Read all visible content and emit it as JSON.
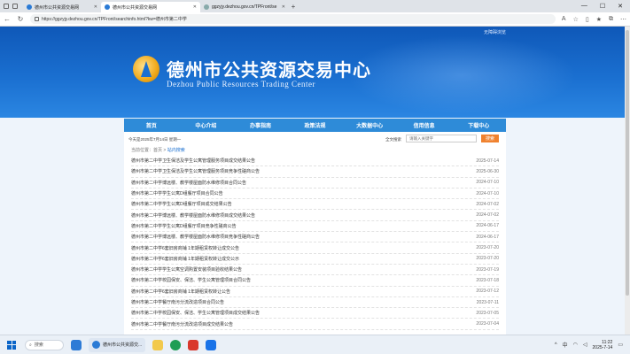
{
  "browser": {
    "tabs": [
      {
        "label": "德州市公共资源交易网",
        "active": false
      },
      {
        "label": "德州市公共资源交易网",
        "active": true
      },
      {
        "label": "ggzyjy.dezhou.gov.cn/TPFront/se",
        "active": false
      }
    ],
    "new_tab_label": "+",
    "url": "https://ggzyjy.dezhou.gov.cn/TPFront/searchinfo.html?kw=德州市第二中学"
  },
  "site": {
    "top_right_text": "无障碍浏览",
    "title_cn": "德州市公共资源交易中心",
    "title_en": "Dezhou Public Resources Trading Center"
  },
  "nav": [
    "首页",
    "中心介绍",
    "办事指南",
    "政策法规",
    "大数据中心",
    "信用信息",
    "下载中心"
  ],
  "info": {
    "date_text": "今天是2025年7月14日 星期一",
    "search_label": "全文搜索",
    "search_placeholder": "请输入关键字",
    "search_button": "搜索"
  },
  "breadcrumb": {
    "prefix": "当前位置：",
    "home": "首页",
    "sep": " > ",
    "current": "站内搜索"
  },
  "results": [
    {
      "title": "德州市第二中学卫生保洁及学生公寓管理服务项目成交结果公告",
      "date": "2025-07-14"
    },
    {
      "title": "德州市第二中学卫生保洁及学生公寓管理服务项目竞争性磋商公告",
      "date": "2025-06-30"
    },
    {
      "title": "德州市第二中学博远楼、教学楼屋面防水维修项目合同公告",
      "date": "2024-07-10"
    },
    {
      "title": "德州市第二中学学生公寓D组餐厅项目合同公告",
      "date": "2024-07-10"
    },
    {
      "title": "德州市第二中学学生公寓D组餐厅项目成交结果公告",
      "date": "2024-07-02"
    },
    {
      "title": "德州市第二中学博远楼、教学楼屋面防水维修项目成交结果公告",
      "date": "2024-07-02"
    },
    {
      "title": "德州市第二中学学生公寓D组餐厅项目竞争性磋商公告",
      "date": "2024-06-17"
    },
    {
      "title": "德州市第二中学博远楼、教学楼屋面防水维修项目竞争性磋商公告",
      "date": "2024-06-17"
    },
    {
      "title": "德州市第二中学6套旧房商铺 1年期租赁权转让成交公告",
      "date": "2023-07-20"
    },
    {
      "title": "德州市第二中学6套旧房商铺 1年期租赁权转让成交公示",
      "date": "2023-07-20"
    },
    {
      "title": "德州市第二中学学生公寓空调购置安装项目验收结果公告",
      "date": "2023-07-19"
    },
    {
      "title": "德州市第二中学校园保安、保洁、学生公寓管理项目合同公告",
      "date": "2023-07-18"
    },
    {
      "title": "德州市第二中学6套旧房商铺 1年期租赁权转让公告",
      "date": "2023-07-12"
    },
    {
      "title": "德州市第二中学餐厅南污分流改造项目合同公告",
      "date": "2023-07-11"
    },
    {
      "title": "德州市第二中学校园保安、保洁、学生公寓管理项目成交结果公告",
      "date": "2023-07-05"
    },
    {
      "title": "德州市第二中学餐厅南污分流改造项目成交结果公告",
      "date": "2023-07-04"
    }
  ],
  "taskbar": {
    "search_label": "搜索",
    "app_label": "德州市公共资源交...",
    "time": "11:22",
    "date": "2025-7-14",
    "lang": "中"
  }
}
